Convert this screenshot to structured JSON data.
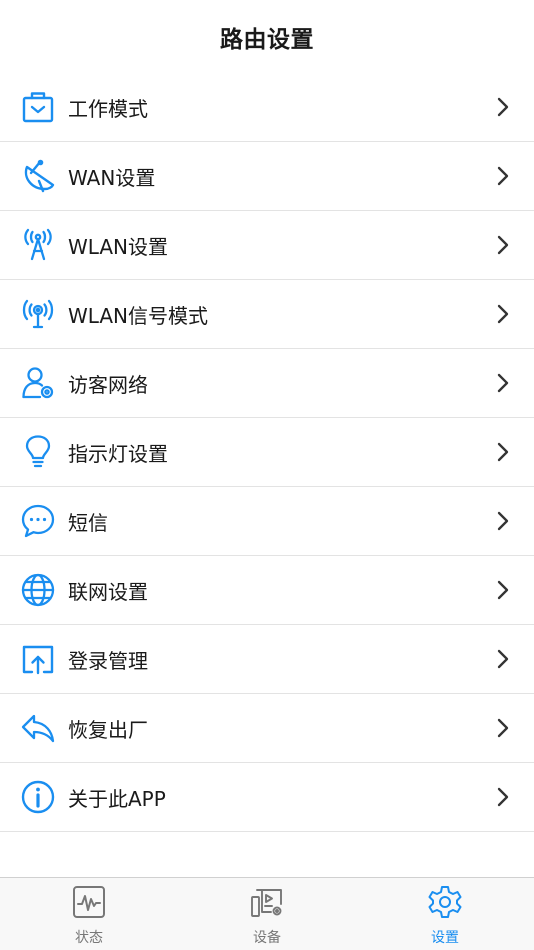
{
  "header": {
    "title": "路由设置"
  },
  "colors": {
    "accent": "#1a8ef0",
    "inactive": "#777777"
  },
  "menu": {
    "items": [
      {
        "label": "工作模式",
        "icon": "briefcase-icon"
      },
      {
        "label": "WAN设置",
        "icon": "satellite-dish-icon"
      },
      {
        "label": "WLAN设置",
        "icon": "antenna-tower-icon"
      },
      {
        "label": "WLAN信号模式",
        "icon": "wireless-signal-icon"
      },
      {
        "label": "访客网络",
        "icon": "guest-user-icon"
      },
      {
        "label": "指示灯设置",
        "icon": "lightbulb-icon"
      },
      {
        "label": "短信",
        "icon": "chat-bubble-icon"
      },
      {
        "label": "联网设置",
        "icon": "globe-icon"
      },
      {
        "label": "登录管理",
        "icon": "upload-screen-icon"
      },
      {
        "label": "恢复出厂",
        "icon": "reply-arrow-icon"
      },
      {
        "label": "关于此APP",
        "icon": "info-icon"
      }
    ]
  },
  "tabbar": {
    "tabs": [
      {
        "label": "状态",
        "icon": "pulse-monitor-icon",
        "active": false
      },
      {
        "label": "设备",
        "icon": "device-settings-icon",
        "active": false
      },
      {
        "label": "设置",
        "icon": "gear-icon",
        "active": true
      }
    ]
  }
}
